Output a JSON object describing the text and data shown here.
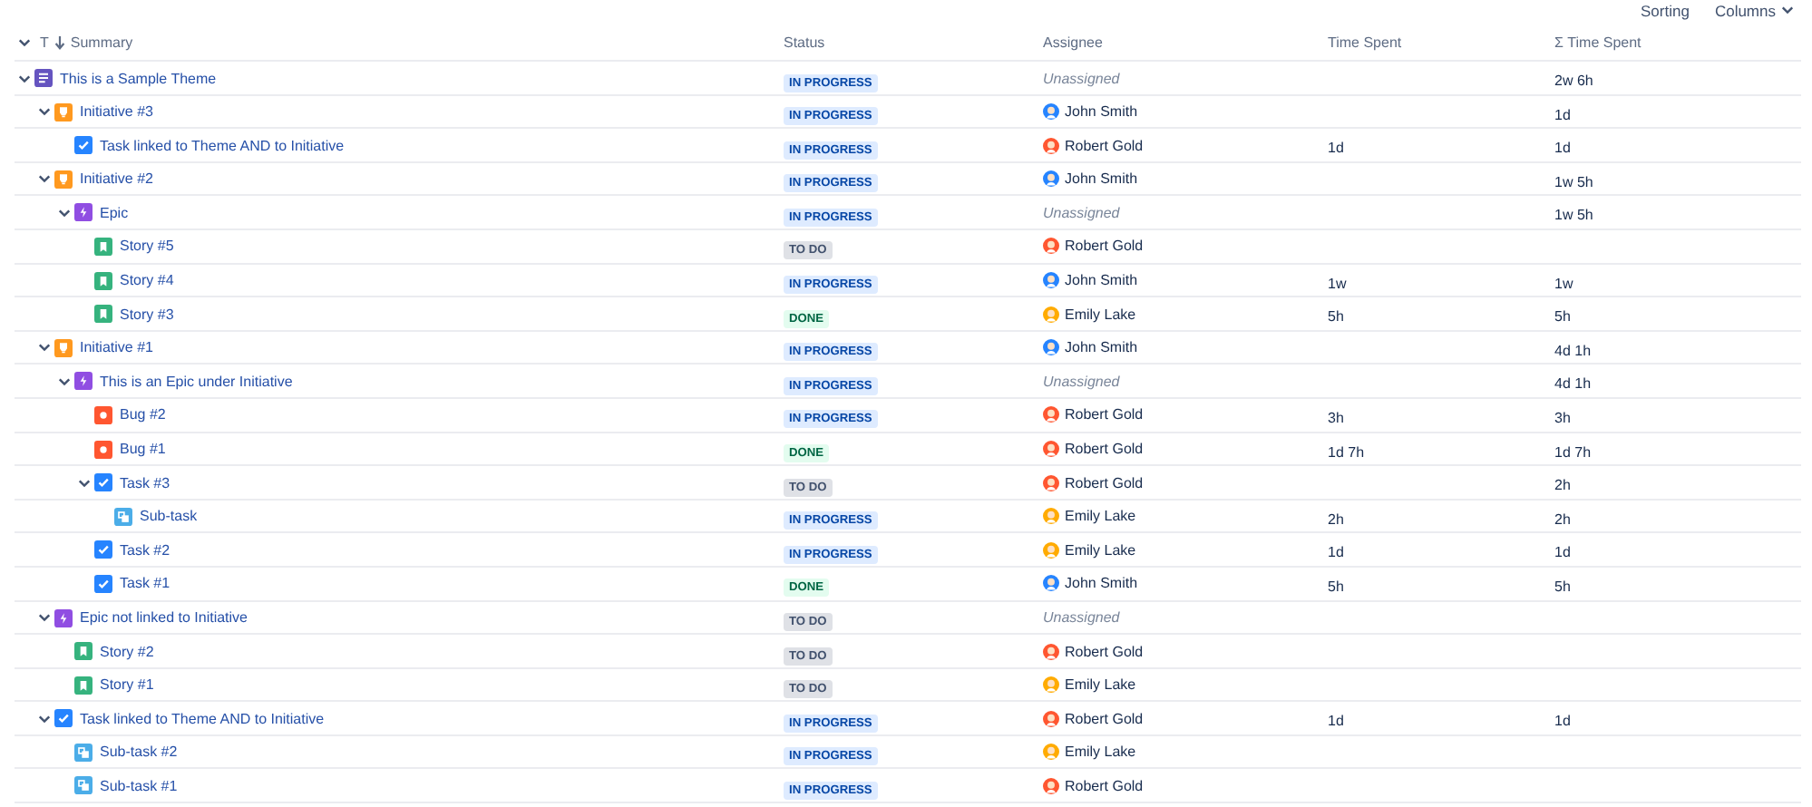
{
  "toolbar": {
    "buttons": [
      {
        "label": "Sorting",
        "has_menu": false
      },
      {
        "label": "Columns",
        "has_menu": true
      }
    ]
  },
  "table": {
    "columns": [
      {
        "label": "Summary",
        "type_label": "T",
        "kind": "summary"
      },
      {
        "label": "Status",
        "kind": "plain"
      },
      {
        "label": "Assignee",
        "kind": "plain"
      },
      {
        "label": "Time Spent",
        "kind": "plain"
      },
      {
        "label": "Σ Time Spent",
        "kind": "plain"
      }
    ],
    "rows": [
      {
        "kind": "theme",
        "summary": "This is a Sample Theme",
        "expanded": true,
        "status": {
          "label": "IN PROGRESS",
          "kind": "inprogress"
        },
        "assignee": {
          "kind": "none",
          "name": "Unassigned"
        },
        "sum_time_spent": "2w 6h",
        "children": [
          {
            "kind": "initiative",
            "summary": "Initiative #3",
            "expanded": true,
            "status": {
              "label": "IN PROGRESS",
              "kind": "inprogress"
            },
            "assignee": {
              "kind": "person",
              "name": "John Smith",
              "color": "#2684ff"
            },
            "sum_time_spent": "1d",
            "children": [
              {
                "kind": "task",
                "summary": "Task linked to Theme AND to Initiative",
                "status": {
                  "label": "IN PROGRESS",
                  "kind": "inprogress"
                },
                "assignee": {
                  "kind": "person",
                  "name": "Robert Gold",
                  "color": "#ff5630"
                },
                "time_spent": "1d",
                "sum_time_spent": "1d"
              }
            ]
          },
          {
            "kind": "initiative",
            "summary": "Initiative #2",
            "expanded": true,
            "status": {
              "label": "IN PROGRESS",
              "kind": "inprogress"
            },
            "assignee": {
              "kind": "person",
              "name": "John Smith",
              "color": "#2684ff"
            },
            "sum_time_spent": "1w 5h",
            "children": [
              {
                "kind": "epic",
                "summary": "Epic",
                "expanded": true,
                "status": {
                  "label": "IN PROGRESS",
                  "kind": "inprogress"
                },
                "assignee": {
                  "kind": "none",
                  "name": "Unassigned"
                },
                "sum_time_spent": "1w 5h",
                "children": [
                  {
                    "kind": "story",
                    "summary": "Story #5",
                    "status": {
                      "label": "TO DO",
                      "kind": "todo"
                    },
                    "assignee": {
                      "kind": "person",
                      "name": "Robert Gold",
                      "color": "#ff5630"
                    }
                  },
                  {
                    "kind": "story",
                    "summary": "Story #4",
                    "status": {
                      "label": "IN PROGRESS",
                      "kind": "inprogress"
                    },
                    "assignee": {
                      "kind": "person",
                      "name": "John Smith",
                      "color": "#2684ff"
                    },
                    "time_spent": "1w",
                    "sum_time_spent": "1w"
                  },
                  {
                    "kind": "story",
                    "summary": "Story #3",
                    "status": {
                      "label": "DONE",
                      "kind": "done"
                    },
                    "assignee": {
                      "kind": "person",
                      "name": "Emily Lake",
                      "color": "#ffab00"
                    },
                    "time_spent": "5h",
                    "sum_time_spent": "5h"
                  }
                ]
              }
            ]
          },
          {
            "kind": "initiative",
            "summary": "Initiative #1",
            "expanded": true,
            "status": {
              "label": "IN PROGRESS",
              "kind": "inprogress"
            },
            "assignee": {
              "kind": "person",
              "name": "John Smith",
              "color": "#2684ff"
            },
            "sum_time_spent": "4d 1h",
            "children": [
              {
                "kind": "epic",
                "summary": "This is an Epic under Initiative",
                "expanded": true,
                "status": {
                  "label": "IN PROGRESS",
                  "kind": "inprogress"
                },
                "assignee": {
                  "kind": "none",
                  "name": "Unassigned"
                },
                "sum_time_spent": "4d 1h",
                "children": [
                  {
                    "kind": "bug",
                    "summary": "Bug #2",
                    "status": {
                      "label": "IN PROGRESS",
                      "kind": "inprogress"
                    },
                    "assignee": {
                      "kind": "person",
                      "name": "Robert Gold",
                      "color": "#ff5630"
                    },
                    "time_spent": "3h",
                    "sum_time_spent": "3h"
                  },
                  {
                    "kind": "bug",
                    "summary": "Bug #1",
                    "status": {
                      "label": "DONE",
                      "kind": "done"
                    },
                    "assignee": {
                      "kind": "person",
                      "name": "Robert Gold",
                      "color": "#ff5630"
                    },
                    "time_spent": "1d 7h",
                    "sum_time_spent": "1d 7h"
                  },
                  {
                    "kind": "task",
                    "summary": "Task #3",
                    "expanded": true,
                    "status": {
                      "label": "TO DO",
                      "kind": "todo"
                    },
                    "assignee": {
                      "kind": "person",
                      "name": "Robert Gold",
                      "color": "#ff5630"
                    },
                    "sum_time_spent": "2h",
                    "children": [
                      {
                        "kind": "subtask",
                        "summary": "Sub-task",
                        "status": {
                          "label": "IN PROGRESS",
                          "kind": "inprogress"
                        },
                        "assignee": {
                          "kind": "person",
                          "name": "Emily Lake",
                          "color": "#ffab00"
                        },
                        "time_spent": "2h",
                        "sum_time_spent": "2h"
                      }
                    ]
                  },
                  {
                    "kind": "task",
                    "summary": "Task #2",
                    "status": {
                      "label": "IN PROGRESS",
                      "kind": "inprogress"
                    },
                    "assignee": {
                      "kind": "person",
                      "name": "Emily Lake",
                      "color": "#ffab00"
                    },
                    "time_spent": "1d",
                    "sum_time_spent": "1d"
                  },
                  {
                    "kind": "task",
                    "summary": "Task #1",
                    "status": {
                      "label": "DONE",
                      "kind": "done"
                    },
                    "assignee": {
                      "kind": "person",
                      "name": "John Smith",
                      "color": "#2684ff"
                    },
                    "time_spent": "5h",
                    "sum_time_spent": "5h"
                  }
                ]
              }
            ]
          },
          {
            "kind": "epic",
            "summary": "Epic not linked to Initiative",
            "expanded": true,
            "status": {
              "label": "TO DO",
              "kind": "todo"
            },
            "assignee": {
              "kind": "none",
              "name": "Unassigned"
            },
            "children": [
              {
                "kind": "story",
                "summary": "Story #2",
                "status": {
                  "label": "TO DO",
                  "kind": "todo"
                },
                "assignee": {
                  "kind": "person",
                  "name": "Robert Gold",
                  "color": "#ff5630"
                }
              },
              {
                "kind": "story",
                "summary": "Story #1",
                "status": {
                  "label": "TO DO",
                  "kind": "todo"
                },
                "assignee": {
                  "kind": "person",
                  "name": "Emily Lake",
                  "color": "#ffab00"
                }
              }
            ]
          },
          {
            "kind": "task",
            "summary": "Task linked to Theme AND to Initiative",
            "expanded": true,
            "status": {
              "label": "IN PROGRESS",
              "kind": "inprogress"
            },
            "assignee": {
              "kind": "person",
              "name": "Robert Gold",
              "color": "#ff5630"
            },
            "time_spent": "1d",
            "sum_time_spent": "1d",
            "children": [
              {
                "kind": "subtask",
                "summary": "Sub-task #2",
                "status": {
                  "label": "IN PROGRESS",
                  "kind": "inprogress"
                },
                "assignee": {
                  "kind": "person",
                  "name": "Emily Lake",
                  "color": "#ffab00"
                }
              },
              {
                "kind": "subtask",
                "summary": "Sub-task #1",
                "status": {
                  "label": "IN PROGRESS",
                  "kind": "inprogress"
                },
                "assignee": {
                  "kind": "person",
                  "name": "Robert Gold",
                  "color": "#ff5630"
                }
              }
            ]
          }
        ]
      }
    ]
  }
}
